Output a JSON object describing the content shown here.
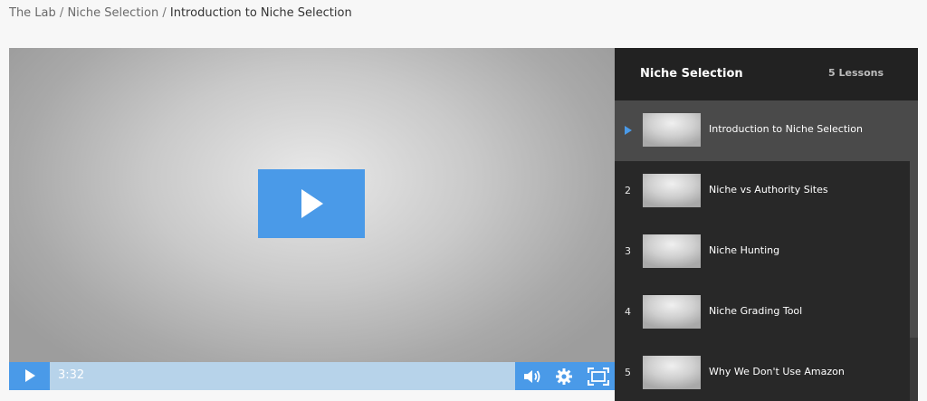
{
  "breadcrumb": {
    "items": [
      "The Lab",
      "Niche Selection"
    ],
    "separator": "/",
    "current": "Introduction to Niche Selection"
  },
  "player": {
    "time": "3:32",
    "colors": {
      "accent": "#4a9ae8",
      "control_bar": "#b7d3ea"
    },
    "icons": [
      "play-icon",
      "volume-icon",
      "settings-gear-icon",
      "fullscreen-icon"
    ]
  },
  "sidebar": {
    "title": "Niche Selection",
    "count": "5 Lessons",
    "lessons": [
      {
        "number": "",
        "title": "Introduction to Niche Selection",
        "active": true
      },
      {
        "number": "2",
        "title": "Niche vs Authority Sites",
        "active": false
      },
      {
        "number": "3",
        "title": "Niche Hunting",
        "active": false
      },
      {
        "number": "4",
        "title": "Niche Grading Tool",
        "active": false
      },
      {
        "number": "5",
        "title": "Why We Don't Use Amazon",
        "active": false
      }
    ]
  }
}
